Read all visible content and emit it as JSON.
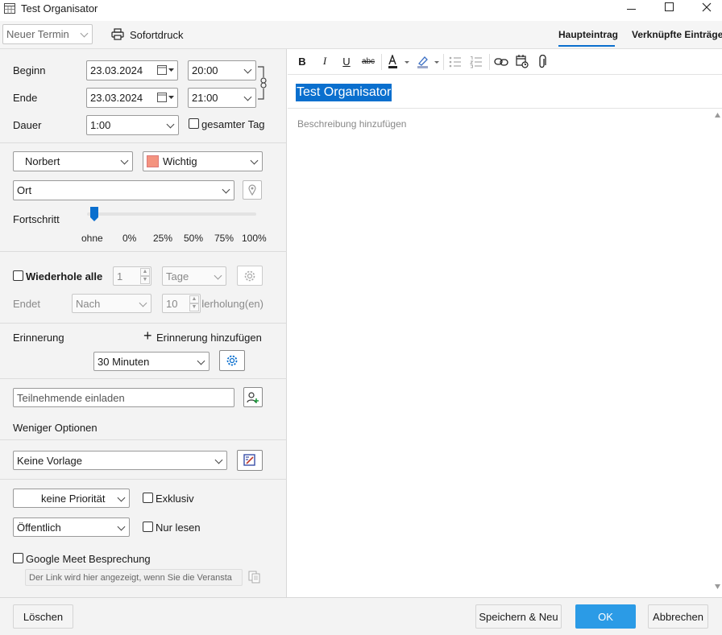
{
  "window": {
    "title": "Test Organisator"
  },
  "toolbar": {
    "new_appointment": "Neuer Termin",
    "quick_print": "Sofortdruck",
    "tabs": [
      "Haupteintrag",
      "Verknüpfte Einträge"
    ]
  },
  "time": {
    "begin_label": "Beginn",
    "begin_date": "23.03.2024",
    "begin_time": "20:00",
    "end_label": "Ende",
    "end_date": "23.03.2024",
    "end_time": "21:00",
    "duration_label": "Dauer",
    "duration": "1:00",
    "all_day_label": "gesamter Tag"
  },
  "details": {
    "owner": "Norbert",
    "category": "Wichtig",
    "category_color": "#f4937f",
    "location_placeholder": "Ort",
    "progress_label": "Fortschritt",
    "progress_ticks": [
      "ohne",
      "0%",
      "25%",
      "50%",
      "75%",
      "100%"
    ],
    "progress_value": "ohne"
  },
  "recurrence": {
    "repeat_label": "Wiederhole alle",
    "interval": "1",
    "unit": "Tage",
    "ends_label": "Endet",
    "ends_mode": "Nach",
    "count": "10",
    "count_suffix": "Wiederholung(en)"
  },
  "reminder": {
    "label": "Erinnerung",
    "add_label": "Erinnerung hinzufügen",
    "value": "30 Minuten"
  },
  "attendees": {
    "placeholder": "Teilnehmende einladen",
    "fewer_options": "Weniger Optionen"
  },
  "template": {
    "value": "Keine Vorlage"
  },
  "options": {
    "priority": "keine Priorität",
    "exclusive_label": "Exklusiv",
    "visibility": "Öffentlich",
    "readonly_label": "Nur lesen"
  },
  "meet": {
    "label": "Google Meet Besprechung",
    "link_placeholder": "Der Link wird hier angezeigt, wenn Sie die Veransta"
  },
  "editor": {
    "title": "Test Organisator",
    "description_placeholder": "Beschreibung hinzufügen"
  },
  "footer": {
    "delete": "Löschen",
    "save_new": "Speichern & Neu",
    "ok": "OK",
    "cancel": "Abbrechen"
  },
  "colors": {
    "accent": "#0a6fce",
    "ok_button": "#2b9be6",
    "selection": "#0a6fce"
  }
}
